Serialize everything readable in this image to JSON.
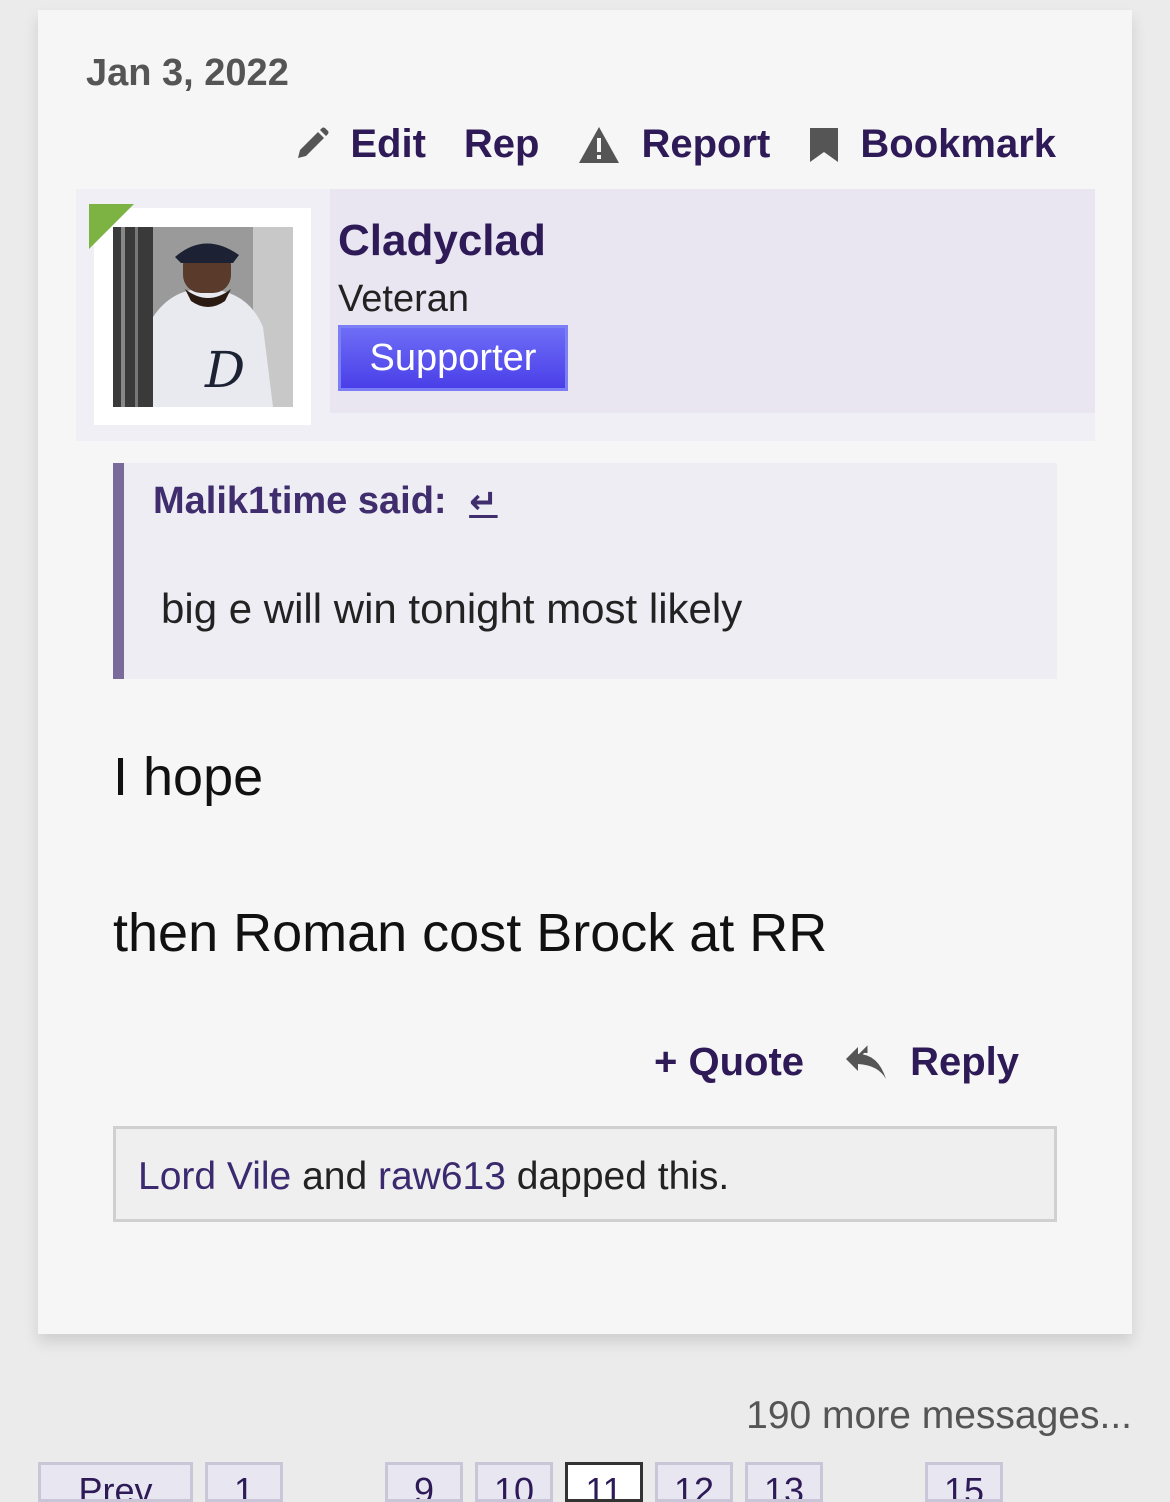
{
  "post": {
    "date": "Jan 3, 2022",
    "actions": {
      "edit": "Edit",
      "rep": "Rep",
      "report": "Report",
      "bookmark": "Bookmark"
    },
    "author": {
      "name": "Cladyclad",
      "title": "Veteran",
      "badge": "Supporter"
    },
    "quote": {
      "attribution": "Malik1time said:",
      "arrow": "↵",
      "text": "big e will win tonight most likely"
    },
    "message": {
      "line1": "I hope",
      "line2": "then Roman cost Brock at RR"
    },
    "footer": {
      "quote": "+ Quote",
      "reply": "Reply"
    },
    "likes": {
      "user1": "Lord Vile",
      "and": "and",
      "user2": "raw613",
      "suffix": "dapped this."
    }
  },
  "more_messages": "190 more messages...",
  "pagination": {
    "prev": "Prev",
    "pages": [
      "1",
      "9",
      "10",
      "11",
      "12",
      "13",
      "15"
    ],
    "current": "11"
  },
  "colors": {
    "accent": "#2d1a57",
    "badge": "#5a52ee",
    "avatar_corner": "#7cb342"
  }
}
